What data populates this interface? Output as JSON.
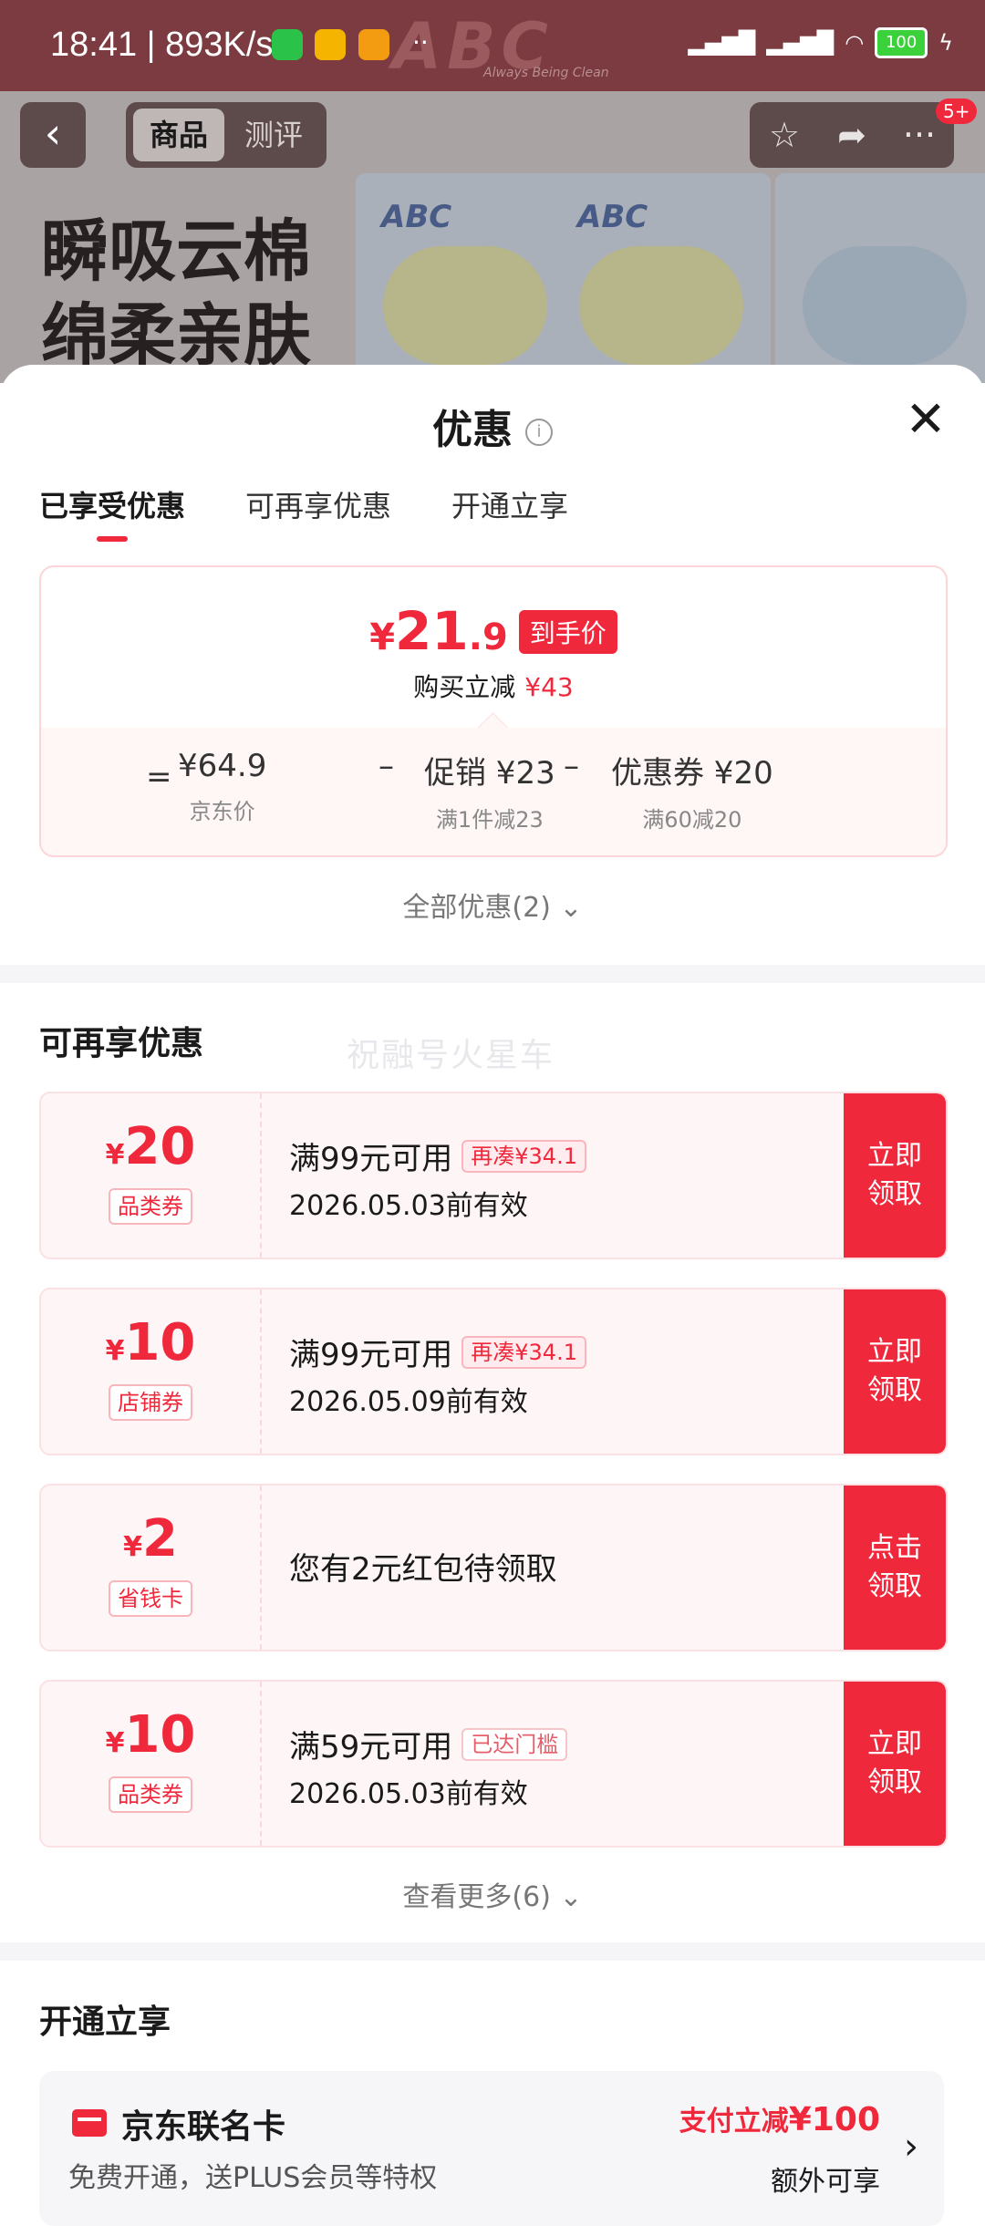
{
  "status_bar": {
    "time": "18:41 | 893K/s",
    "battery": "100"
  },
  "background": {
    "logo": "ABC",
    "logo_sub": "Always Being Clean",
    "slogan_line1": "瞬吸云棉",
    "slogan_line2": "绵柔亲肤",
    "pack_brand": "ABC"
  },
  "top_nav": {
    "tab_product": "商品",
    "tab_review": "测评",
    "badge": "5+"
  },
  "sheet": {
    "title": "优惠",
    "tabs": [
      "已享受优惠",
      "可再享优惠",
      "开通立享"
    ],
    "summary": {
      "yen": "¥",
      "price_int": "21",
      "price_dec": ".9",
      "price_tag": "到手价",
      "reduce_label": "购买立减",
      "reduce_value": "¥43",
      "eq": "=",
      "minus": "–",
      "jd_price": "¥64.9",
      "jd_price_label": "京东价",
      "promo": "促销 ¥23",
      "promo_label": "满1件减23",
      "coupon": "优惠券 ¥20",
      "coupon_label": "满60减20"
    },
    "all_offers": "全部优惠(2) ⌄"
  },
  "more_offers": {
    "title": "可再享优惠",
    "watermark": "祝融号火星车",
    "coupons": [
      {
        "yen": "¥",
        "amount": "20",
        "type": "品类券",
        "condition": "满99元可用",
        "chip": "再凑¥34.1",
        "valid": "2026.05.03前有效",
        "button": "立即\n领取"
      },
      {
        "yen": "¥",
        "amount": "10",
        "type": "店铺券",
        "condition": "满99元可用",
        "chip": "再凑¥34.1",
        "valid": "2026.05.09前有效",
        "button": "立即\n领取"
      },
      {
        "yen": "¥",
        "amount": "2",
        "type": "省钱卡",
        "condition": "您有2元红包待领取",
        "button": "点击\n领取"
      },
      {
        "yen": "¥",
        "amount": "10",
        "type": "品类券",
        "condition": "满59元可用",
        "chip": "已达门槛",
        "valid": "2026.05.03前有效",
        "button": "立即\n领取"
      }
    ],
    "see_more": "查看更多(6) ⌄"
  },
  "membership": {
    "title": "开通立享",
    "card_name": "京东联名卡",
    "card_desc": "免费开通，送PLUS会员等特权",
    "promo_label": "支付立减",
    "promo_value": "¥100",
    "extra": "额外可享"
  },
  "colors": {
    "accent": "#f0283c",
    "coupon_bg": "#fef6f6"
  }
}
